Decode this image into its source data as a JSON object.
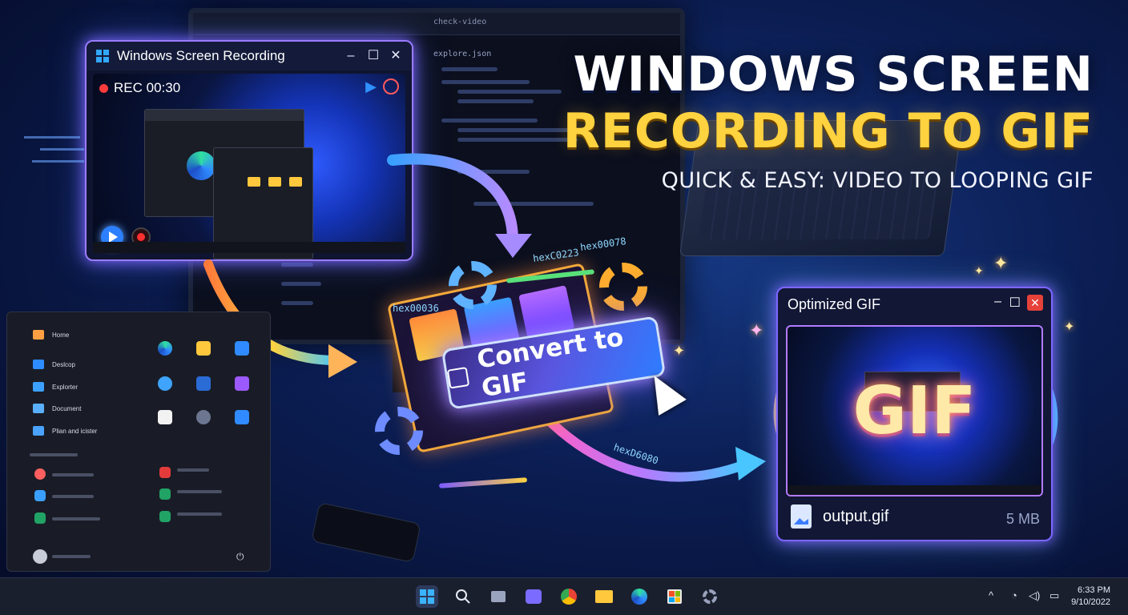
{
  "recording_window": {
    "title": "Windows Screen Recording",
    "rec_time": "REC 00:30",
    "controls": [
      "minimize",
      "maximize",
      "close"
    ]
  },
  "headline": {
    "line1": "WINDOWS SCREEN",
    "line2": "RECORDING TO GIF",
    "subtitle": "QUICK & EASY: VIDEO TO LOOPING GIF"
  },
  "converter": {
    "button_label": "Convert to GIF",
    "hex_labels": [
      "hex00036",
      "hexC0223",
      "hex00078",
      "hexD6080"
    ]
  },
  "code_editor": {
    "tab_title": "check-video",
    "file_name": "explore.json"
  },
  "gif_window": {
    "title": "Optimized GIF",
    "preview_text": "GIF",
    "file_name": "output.gif",
    "file_size": "5 MB"
  },
  "start_menu": {
    "items": [
      {
        "label": "Home",
        "icon": "home-icon"
      },
      {
        "label": "Deslcop",
        "icon": "desktop-icon"
      },
      {
        "label": "Explorter",
        "icon": "explorer-icon"
      },
      {
        "label": "Document",
        "icon": "document-icon"
      },
      {
        "label": "Plian and icister",
        "icon": "apps-icon"
      }
    ]
  },
  "taskbar": {
    "time": "6:33 PM",
    "date": "9/10/2022",
    "icons": [
      "windows-start-icon",
      "search-icon",
      "task-view-icon",
      "teams-icon",
      "chrome-icon",
      "file-explorer-icon",
      "edge-icon",
      "store-icon",
      "settings-icon"
    ]
  },
  "colors": {
    "accent_yellow": "#ffd23f",
    "glow_purple": "#9a7cff",
    "rec_red": "#ff3b3b",
    "taskbar_bg": "#1a1f2e"
  }
}
